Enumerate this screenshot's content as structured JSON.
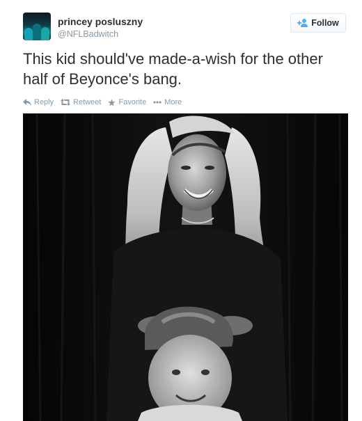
{
  "user": {
    "name": "princey posluszny",
    "handle": "@NFLBadwitch"
  },
  "follow_button": {
    "label": "Follow",
    "icon": "add-user-icon"
  },
  "tweet": {
    "text": "This kid should've made-a-wish for the other half of Beyonce's bang."
  },
  "actions": [
    {
      "label": "Reply",
      "icon": "reply-icon"
    },
    {
      "label": "Retweet",
      "icon": "retweet-icon"
    },
    {
      "label": "Favorite",
      "icon": "star-icon"
    },
    {
      "label": "More",
      "icon": "ellipsis-icon"
    }
  ],
  "colors": {
    "text": "#292f33",
    "muted": "#8899a6",
    "accent": "#55acee",
    "border": "#e1e8ed"
  },
  "photo": {
    "style": "black-and-white photo"
  }
}
